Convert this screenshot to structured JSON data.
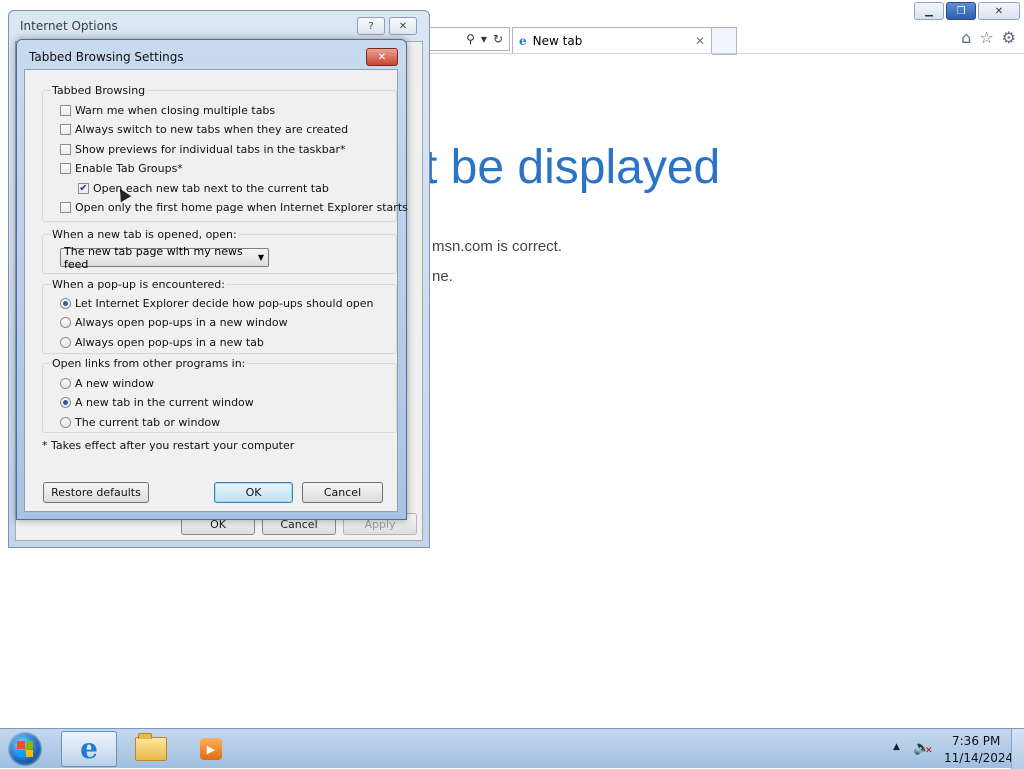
{
  "browser": {
    "tab_title": "New tab",
    "tab_close": "✕",
    "error_title": "t be displayed",
    "error_line1": "msn.com is correct.",
    "error_line2": "ne."
  },
  "internet_options": {
    "title": "Internet Options",
    "help_label": "?",
    "close_label": "✕",
    "ok_label": "OK",
    "cancel_label": "Cancel",
    "apply_label": "Apply"
  },
  "dialog": {
    "title": "Tabbed Browsing Settings",
    "close_label": "✕",
    "tabbed_browsing": {
      "legend": "Tabbed Browsing",
      "options": [
        {
          "label": "Warn me when closing multiple tabs",
          "checked": false
        },
        {
          "label": "Always switch to new tabs when they are created",
          "checked": false
        },
        {
          "label": "Show previews for individual tabs in the taskbar*",
          "checked": false
        },
        {
          "label": "Enable Tab Groups*",
          "checked": false
        },
        {
          "label": "Open each new tab next to the current tab",
          "checked": true
        },
        {
          "label": "Open only the first home page when Internet Explorer starts",
          "checked": false
        }
      ]
    },
    "new_tab": {
      "legend": "When a new tab is opened, open:",
      "selected": "The new tab page with my news feed"
    },
    "popup": {
      "legend": "When a pop-up is encountered:",
      "options": [
        {
          "label": "Let Internet Explorer decide how pop-ups should open",
          "selected": true
        },
        {
          "label": "Always open pop-ups in a new window",
          "selected": false
        },
        {
          "label": "Always open pop-ups in a new tab",
          "selected": false
        }
      ]
    },
    "links": {
      "legend": "Open links from other programs in:",
      "options": [
        {
          "label": "A new window",
          "selected": false
        },
        {
          "label": "A new tab in the current window",
          "selected": true
        },
        {
          "label": "The current tab or window",
          "selected": false
        }
      ]
    },
    "note": "* Takes effect after you restart your computer",
    "restore_label": "Restore defaults",
    "ok_label": "OK",
    "cancel_label": "Cancel"
  },
  "taskbar": {
    "time": "7:36 PM",
    "date": "11/14/2024"
  }
}
